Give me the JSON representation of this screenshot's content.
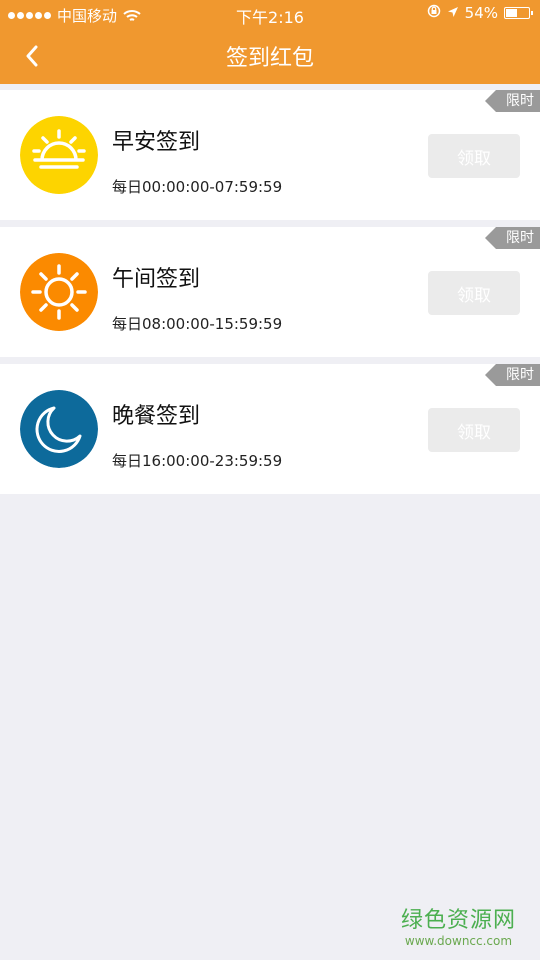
{
  "status_bar": {
    "carrier": "中国移动",
    "time": "下午2:16",
    "battery": "54%",
    "battery_level": 0.54
  },
  "nav": {
    "title": "签到红包",
    "back_icon": "chevron-left-icon"
  },
  "cards": [
    {
      "title": "早安签到",
      "time": "每日00:00:00-07:59:59",
      "button": "领取",
      "tag": "限时",
      "icon": "sunrise-icon",
      "icon_color": "#fdd400"
    },
    {
      "title": "午间签到",
      "time": "每日08:00:00-15:59:59",
      "button": "领取",
      "tag": "限时",
      "icon": "sun-icon",
      "icon_color": "#fb8a00"
    },
    {
      "title": "晚餐签到",
      "time": "每日16:00:00-23:59:59",
      "button": "领取",
      "tag": "限时",
      "icon": "moon-icon",
      "icon_color": "#0d6a9b"
    }
  ],
  "watermark": {
    "title": "绿色资源网",
    "url": "www.downcc.com"
  },
  "colors": {
    "header": "#f0982f",
    "background": "#efeff4",
    "button": "#ebebeb",
    "tag": "#9a9a9a"
  }
}
